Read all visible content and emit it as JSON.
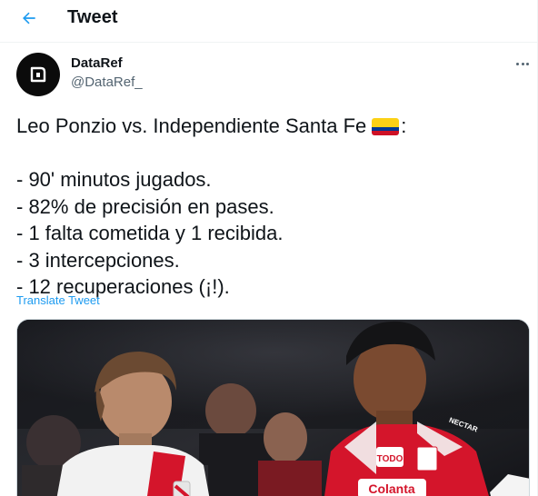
{
  "header": {
    "title": "Tweet",
    "back_icon": "arrow-left-icon"
  },
  "tweet": {
    "author": {
      "display_name": "DataRef",
      "handle": "@DataRef_"
    },
    "text_lines": [
      "Leo Ponzio vs. Independiente Santa Fe",
      "",
      "- 90' minutos jugados.",
      "- 82% de precisión en pases.",
      "- 1 falta cometida y 1 recibida.",
      "- 3 intercepciones.",
      "- 12 recuperaciones (¡!)."
    ],
    "line_suffix": ":",
    "flag_icon": "colombia-flag-icon",
    "translate_label": "Translate Tweet",
    "media": {
      "jersey_left_text": "",
      "sponsor_left": "TODO",
      "sponsor_bottom": "Colanta",
      "sleeve_text": "NECTAR"
    }
  },
  "colors": {
    "accent": "#1d9bf0",
    "text": "#0f1419",
    "secondary": "#536471",
    "santa_fe_red": "#d4152b"
  }
}
